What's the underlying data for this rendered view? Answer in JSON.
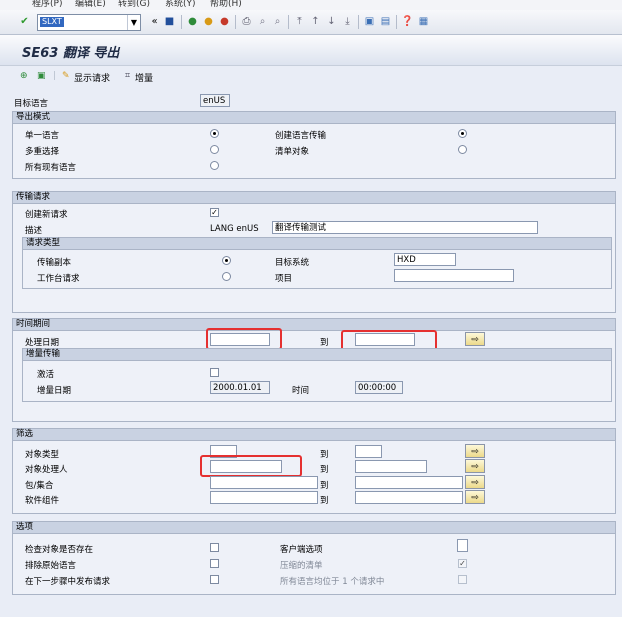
{
  "menu": [
    "程序(P)",
    "编辑(E)",
    "转到(G)",
    "系统(Y)",
    "帮助(H)"
  ],
  "toolbar": {
    "command": "SLXT"
  },
  "title": "SE63 翻译 导出",
  "app_toolbar": {
    "show_request": "显示请求",
    "incremental": "增量"
  },
  "target_language": {
    "label": "目标语言",
    "value": "enUS"
  },
  "export_mode": {
    "header": "导出模式",
    "single_language": "单一语言",
    "multi_select": "多重选择",
    "all_languages": "所有现有语言",
    "create_transport": "创建语言传输",
    "list_objects": "清单对象"
  },
  "transport_request": {
    "header": "传输请求",
    "create_new": "创建新请求",
    "description_label": "描述",
    "lang": "LANG enUS",
    "description_value": "翻译传输测试",
    "request_type_header": "请求类型",
    "transport_copy": "传输副本",
    "workbench_request": "工作台请求",
    "target_system_label": "目标系统",
    "target_system_value": "HXD",
    "project_label": "项目"
  },
  "time_period": {
    "header": "时间期间",
    "processing_date": "处理日期",
    "to": "到",
    "incremental_header": "增量传输",
    "activate": "激活",
    "incremental_date": "增量日期",
    "incremental_date_value": "2000.01.01",
    "time_label": "时间",
    "time_value": "00:00:00"
  },
  "filter": {
    "header": "筛选",
    "object_type": "对象类型",
    "object_processor": "对象处理人",
    "package": "包/集合",
    "software_component": "软件组件",
    "to": "到"
  },
  "options": {
    "header": "选项",
    "check_object_exists": "检查对象是否存在",
    "exclude_original": "排除原始语言",
    "release_next_step": "在下一步骤中发布请求",
    "client_option": "客户端选项",
    "compressed_list": "压缩的清单",
    "all_languages_one_request": "所有语言均位于 1 个请求中"
  },
  "colors": {
    "highlight": "#e53030",
    "group_header": "#c9d2e2"
  }
}
